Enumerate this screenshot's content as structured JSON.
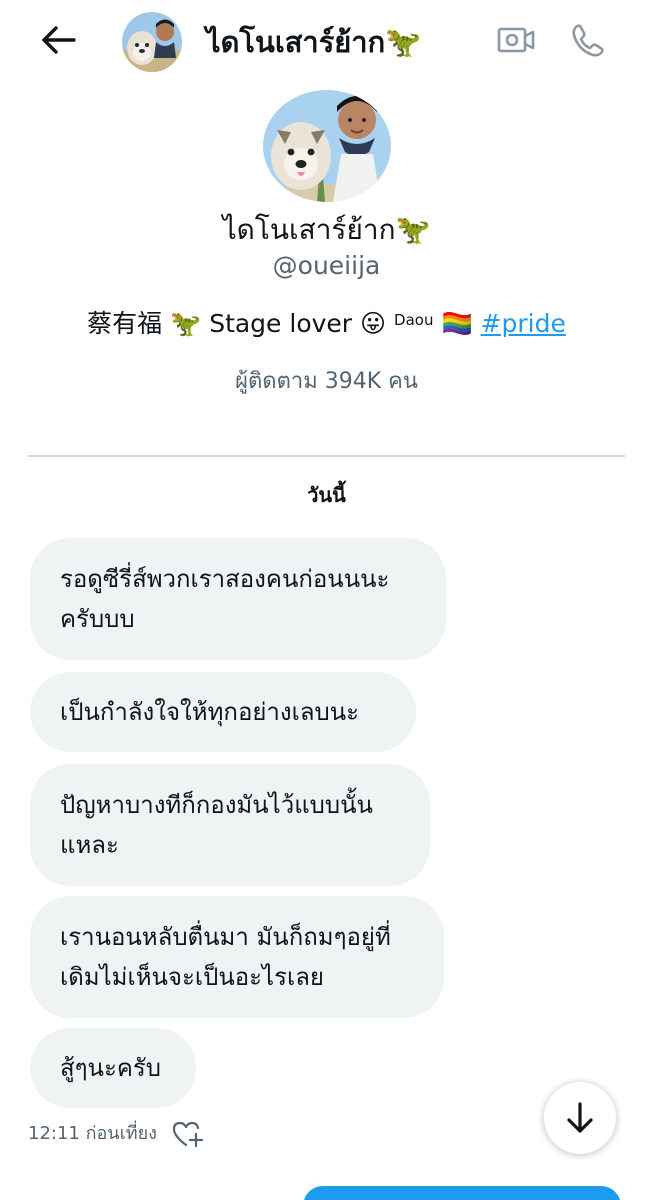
{
  "header": {
    "name": "ไดโนเสาร์ย้าก🦖",
    "back_icon": "arrow-left-icon",
    "video_icon": "video-camera-icon",
    "call_icon": "phone-icon"
  },
  "profile": {
    "name": "ไดโนเสาร์ย้าก🦖",
    "handle": "@oueiija",
    "bio_text": "蔡有福 🦖 Stage lover 😛",
    "bio_sup": "Daou",
    "bio_flag": "🏳️‍🌈",
    "bio_hashtag": "#pride",
    "followers": "ผู้ติดตาม 394K คน"
  },
  "conversation": {
    "day_label": "วันนี้",
    "messages": [
      {
        "line1": "รอดูซีรี่ส์พวกเราสองคนก่อนนนะ",
        "line2": "ครับบบ"
      },
      {
        "line1": "เป็นกำลังใจให้ทุกอย่างเลบนะ",
        "line2": ""
      },
      {
        "line1": "ปัญหาบางทีก็กองมันไว้แบบนั้น",
        "line2": "แหละ"
      },
      {
        "line1": "เรานอนหลับตื่นมา มันก็ถมๆอยู่ที่",
        "line2": "เดิมไม่เห็นจะเป็นอะไรเลย"
      },
      {
        "line1": "สู้ๆนะครับ",
        "line2": ""
      }
    ],
    "timestamp": "12:11 ก่อนเที่ยง"
  },
  "colors": {
    "accent": "#1d9bf0",
    "bubble_bg": "#eff3f4",
    "secondary_text": "#536471",
    "divider": "#cfd9de"
  }
}
